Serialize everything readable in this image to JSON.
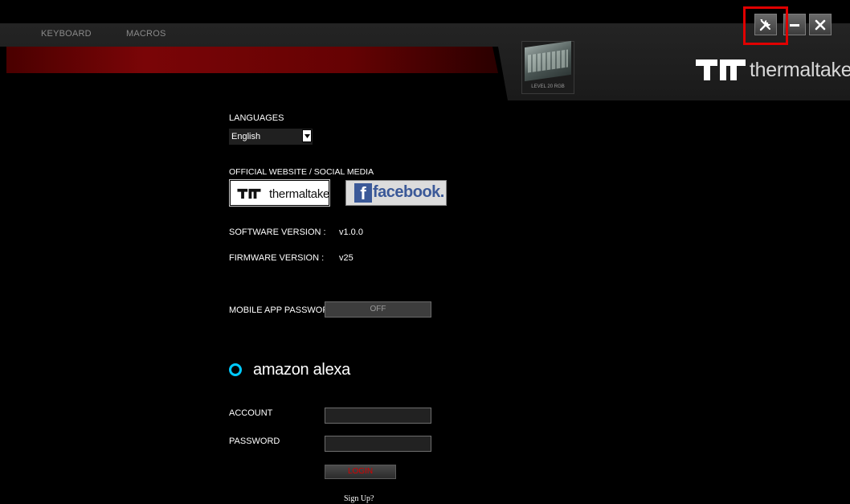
{
  "nav": {
    "tabs": [
      {
        "label": "KEYBOARD"
      },
      {
        "label": "MACROS"
      }
    ]
  },
  "device": {
    "name": "LEVEL 20 RGB"
  },
  "brand": {
    "wordmark": "thermaltake"
  },
  "window_controls": {
    "icons": [
      "settings-icon",
      "minimize-icon",
      "close-icon"
    ],
    "highlighted": "settings"
  },
  "settings": {
    "languages_label": "LANGUAGES",
    "language_selected": "English",
    "social_label": "OFFICIAL WEBSITE / SOCIAL MEDIA",
    "website_link": "thermaltake",
    "facebook_link": "facebook.",
    "software_version_label": "SOFTWARE VERSION :",
    "software_version": "v1.0.0",
    "firmware_version_label": "FIRMWARE VERSION :",
    "firmware_version": "v25",
    "mobile_app_password_label": "MOBILE APP PASSWOR",
    "mobile_app_password_toggle": "OFF"
  },
  "alexa": {
    "logo_text": "amazon alexa",
    "account_label": "ACCOUNT",
    "account_value": "",
    "password_label": "PASSWORD",
    "password_value": "",
    "login_label": "LOGIN",
    "signup_label": "Sign Up?"
  },
  "colors": {
    "accent_red": "#7a0507",
    "highlight_red": "#e00000",
    "alexa_blue": "#00caff",
    "facebook_blue": "#3b5998"
  }
}
